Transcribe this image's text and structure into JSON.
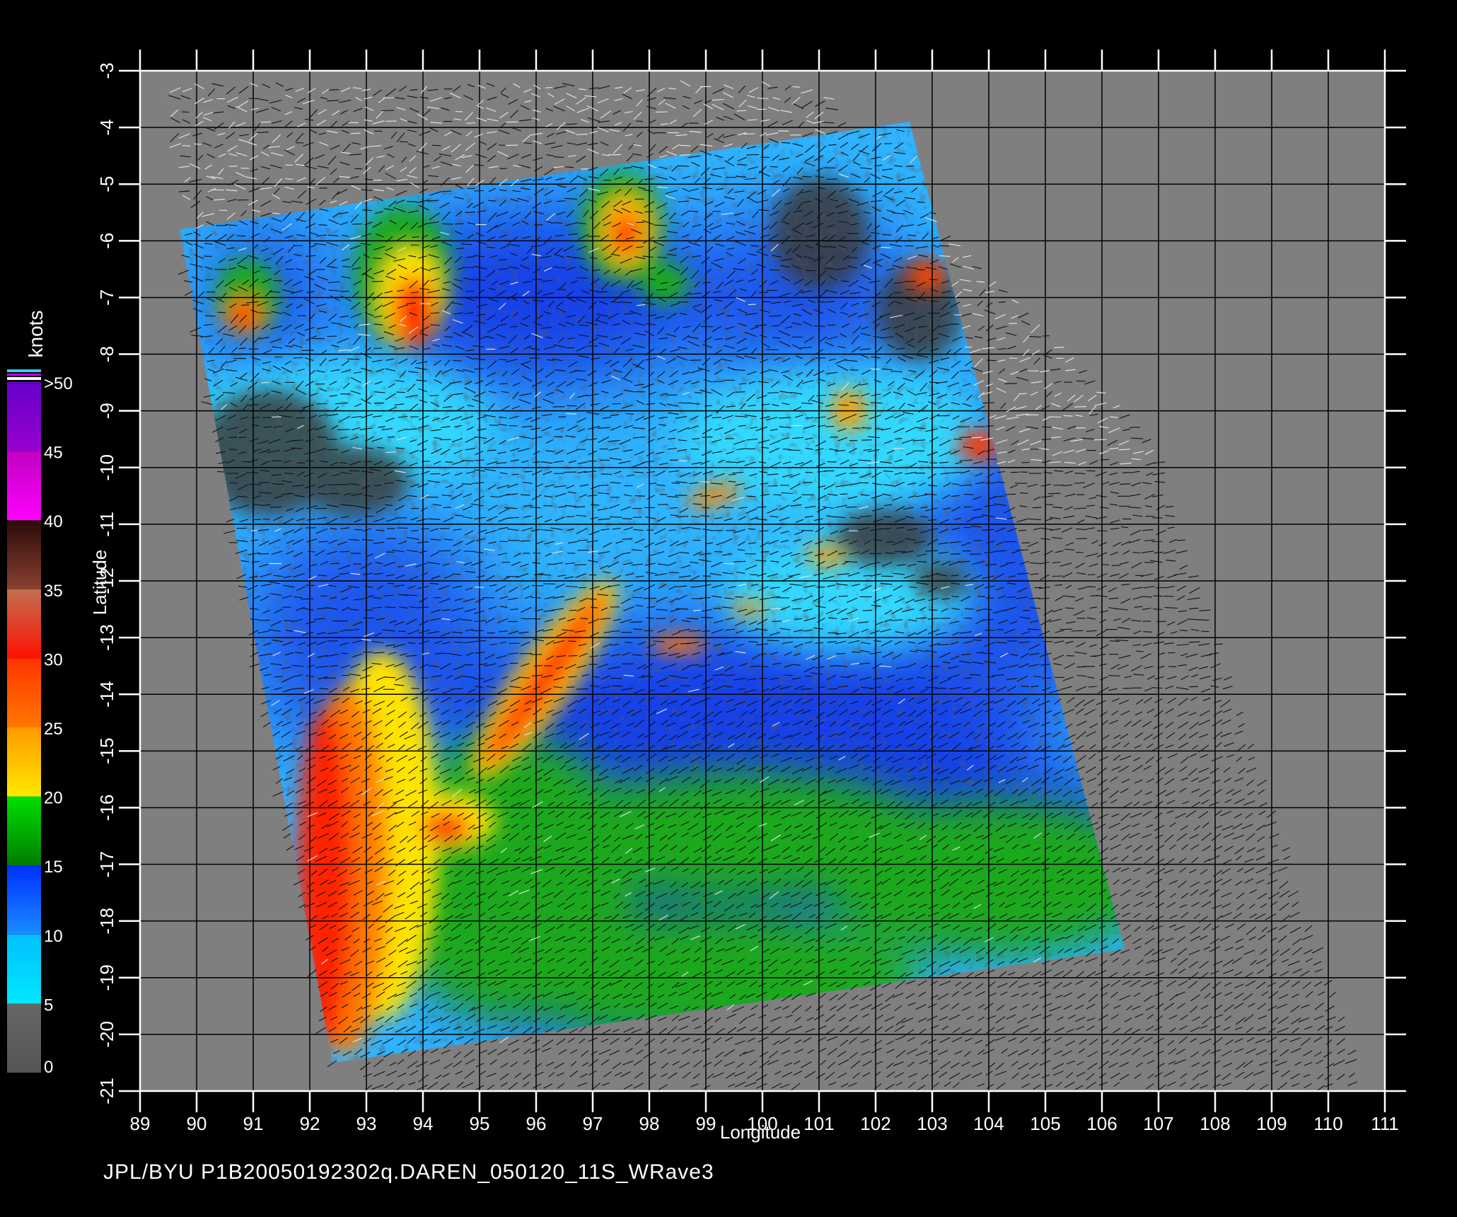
{
  "axes": {
    "xlabel": "Longitude",
    "ylabel": "Latitude",
    "xlim": [
      89,
      111
    ],
    "ylim": [
      -21,
      -3
    ],
    "xticks": [
      "89",
      "90",
      "91",
      "92",
      "93",
      "94",
      "95",
      "96",
      "97",
      "98",
      "99",
      "100",
      "101",
      "102",
      "103",
      "104",
      "105",
      "106",
      "107",
      "108",
      "109",
      "110",
      "111"
    ],
    "yticks": [
      "-3",
      "-4",
      "-5",
      "-6",
      "-7",
      "-8",
      "-9",
      "-10",
      "-11",
      "-12",
      "-13",
      "-14",
      "-15",
      "-16",
      "-17",
      "-18",
      "-19",
      "-20",
      "-21"
    ],
    "grid": true
  },
  "colorbar": {
    "title": "knots",
    "tick_labels": [
      "0",
      "5",
      "10",
      "15",
      "20",
      "25",
      "30",
      "35",
      "40",
      "45",
      ">50"
    ],
    "bands": [
      {
        "from": 0,
        "to": 5,
        "top": "#666666",
        "bottom": "#555555"
      },
      {
        "from": 5,
        "to": 10,
        "top": "#00bfff",
        "bottom": "#00e8ff"
      },
      {
        "from": 10,
        "to": 15,
        "top": "#0030ff",
        "bottom": "#1a8cff"
      },
      {
        "from": 15,
        "to": 20,
        "top": "#00e000",
        "bottom": "#007a00"
      },
      {
        "from": 20,
        "to": 25,
        "top": "#ff9900",
        "bottom": "#ffe800"
      },
      {
        "from": 25,
        "to": 30,
        "top": "#ff3300",
        "bottom": "#ff7700"
      },
      {
        "from": 30,
        "to": 35,
        "top": "#c07050",
        "bottom": "#ff1100"
      },
      {
        "from": 35,
        "to": 40,
        "top": "#2a0a0a",
        "bottom": "#8a4030"
      },
      {
        "from": 40,
        "to": 45,
        "top": "#c000c0",
        "bottom": "#ff00ff"
      },
      {
        "from": 45,
        "to": 50,
        "top": "#6600cc",
        "bottom": "#9900cc"
      }
    ]
  },
  "swath": {
    "corners_lonlat": [
      [
        89.7,
        -5.8
      ],
      [
        102.6,
        -3.9
      ],
      [
        106.4,
        -18.5
      ],
      [
        92.4,
        -20.5
      ]
    ]
  },
  "colors": {
    "background": "#000000",
    "no_data": "#7f7f7f",
    "low_wind": "#3a3a3a",
    "calm_blue": "#1540e8",
    "light_blue": "#2fb4ff",
    "cyan": "#30d8ff",
    "green": "#1fa81f",
    "yellow": "#ffe400",
    "orange": "#ff7a00",
    "red": "#ff2200"
  },
  "footer": {
    "text": "JPL/BYU  P1B20050192302q.DAREN_050120_11S_WRave3"
  }
}
